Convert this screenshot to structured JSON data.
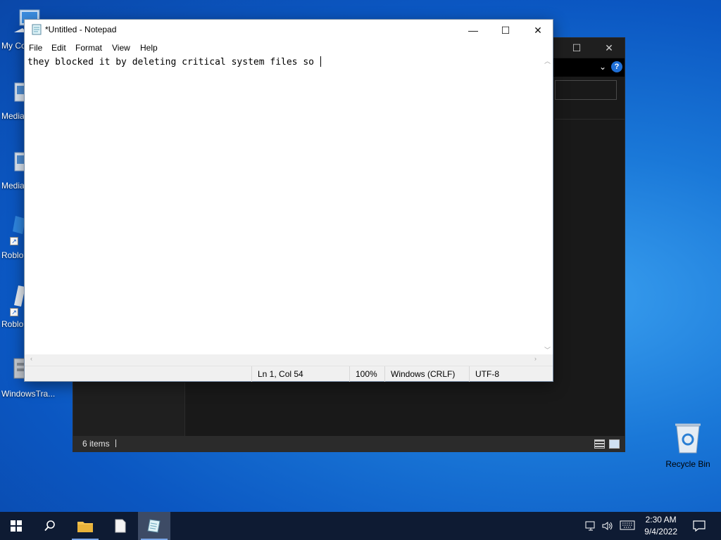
{
  "desktop": {
    "icons": [
      {
        "name": "my-computer",
        "label": "My Co"
      },
      {
        "name": "media-1",
        "label": "Media"
      },
      {
        "name": "media-2",
        "label": "Media"
      },
      {
        "name": "roblox-1",
        "label": "Roblo"
      },
      {
        "name": "roblox-2",
        "label": "Roblo"
      },
      {
        "name": "windowstra",
        "label": "WindowsTra..."
      }
    ],
    "recycle_bin": {
      "label": "Recycle Bin",
      "icon": "recycle-bin-icon"
    }
  },
  "explorer": {
    "theme": "dark",
    "maximize_glyph": "☐",
    "close_glyph": "✕",
    "chevron_glyph": "⌄",
    "help_glyph": "?",
    "status": {
      "items_text": "6 items"
    }
  },
  "notepad": {
    "title": "*Untitled - Notepad",
    "controls": {
      "minimize": "—",
      "maximize": "☐",
      "close": "✕"
    },
    "menu": [
      "File",
      "Edit",
      "Format",
      "View",
      "Help"
    ],
    "content": "they blocked it by deleting critical system files so ",
    "statusbar": {
      "position": "Ln 1, Col 54",
      "zoom": "100%",
      "line_ending": "Windows (CRLF)",
      "encoding": "UTF-8"
    }
  },
  "taskbar": {
    "apps": [
      {
        "name": "start",
        "icon": "windows-logo-icon"
      },
      {
        "name": "search",
        "icon": "search-icon"
      },
      {
        "name": "file-explorer",
        "icon": "folder-icon"
      },
      {
        "name": "blank-file",
        "icon": "document-icon"
      },
      {
        "name": "notepad",
        "icon": "notepad-icon"
      }
    ],
    "tray": {
      "time": "2:30 AM",
      "date": "9/4/2022"
    }
  },
  "colors": {
    "desktop_blue": "#0b57c2",
    "taskbar": "#0e1b33",
    "explorer_bg": "#191919",
    "accent": "#1f6fd6"
  }
}
